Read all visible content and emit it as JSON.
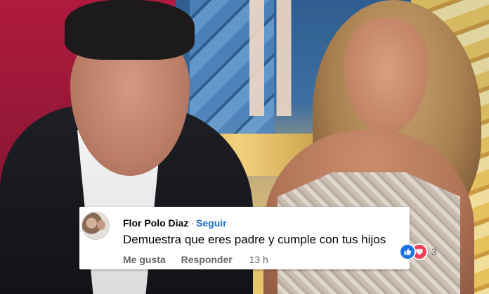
{
  "photo": {
    "description_icons": [
      "man-figure",
      "woman-figure",
      "stained-glass-background"
    ]
  },
  "comment": {
    "author": "Flor Polo Diaz",
    "separator": "·",
    "follow_label": "Seguir",
    "text": "Demuestra que eres padre y cumple con tus hijos",
    "reaction_icons": [
      "like-icon",
      "love-icon"
    ],
    "reaction_count": "3",
    "like_label": "Me gusta",
    "reply_label": "Responder",
    "timestamp": "13 h"
  },
  "colors": {
    "follow_blue": "#216fdb",
    "like_blue": "#1b74e4",
    "love_red": "#f33e58",
    "secondary_text": "#65676b"
  }
}
